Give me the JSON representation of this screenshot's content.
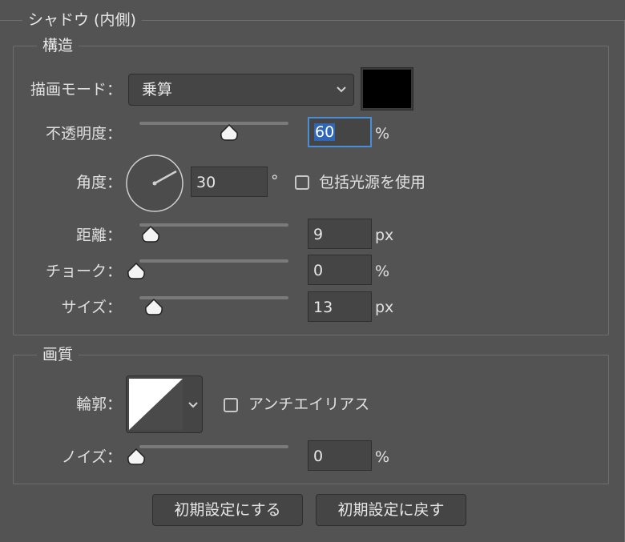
{
  "panel": {
    "title": "シャドウ (内側)"
  },
  "structure": {
    "legend": "構造",
    "blend_mode": {
      "label": "描画モード：",
      "value": "乗算",
      "swatch_color": "#000000"
    },
    "opacity": {
      "label": "不透明度：",
      "value": "60",
      "unit": "%",
      "slider_fraction": 0.6
    },
    "angle": {
      "label": "角度：",
      "value": "30",
      "unit": "°",
      "global_light_label": "包括光源を使用",
      "global_light_checked": false
    },
    "distance": {
      "label": "距離：",
      "value": "9",
      "unit": "px",
      "slider_fraction": 0.05
    },
    "choke": {
      "label": "チョーク：",
      "value": "0",
      "unit": "%",
      "slider_fraction": 0.0
    },
    "size": {
      "label": "サイズ：",
      "value": "13",
      "unit": "px",
      "slider_fraction": 0.07
    }
  },
  "quality": {
    "legend": "画質",
    "contour": {
      "label": "輪郭："
    },
    "antialias": {
      "label": "アンチエイリアス",
      "checked": false
    },
    "noise": {
      "label": "ノイズ：",
      "value": "0",
      "unit": "%",
      "slider_fraction": 0.0
    }
  },
  "buttons": {
    "make_default": "初期設定にする",
    "reset_default": "初期設定に戻す"
  },
  "colors": {
    "accent": "#4a8ed8",
    "background": "#535353",
    "swatch": "#000000"
  }
}
